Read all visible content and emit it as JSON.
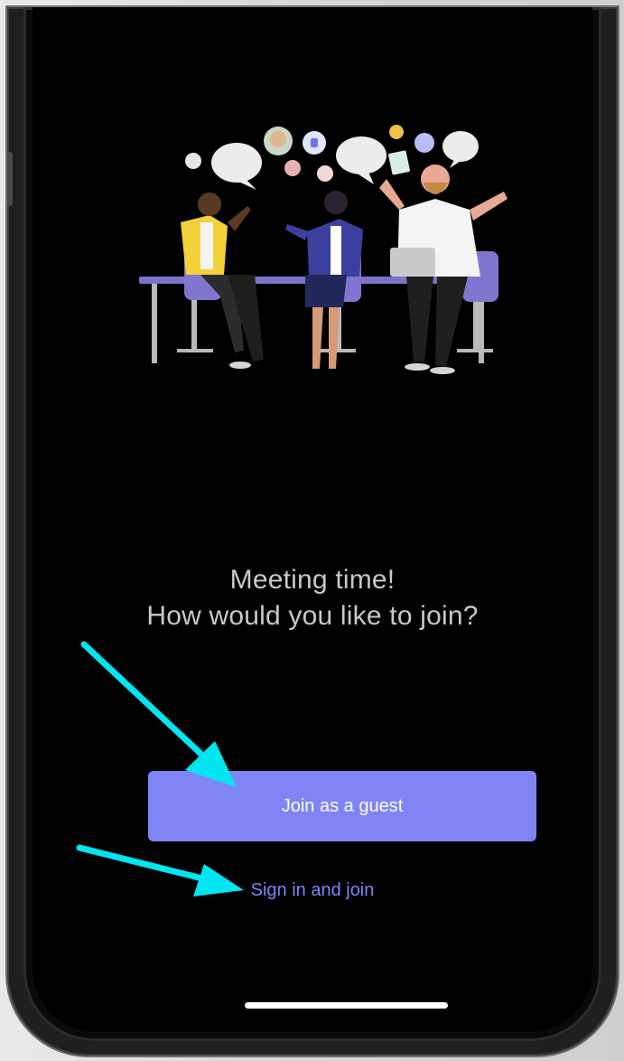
{
  "prompt": {
    "line1": "Meeting time!",
    "line2": "How would you like to join?"
  },
  "actions": {
    "join_guest_label": "Join as a guest",
    "sign_in_label": "Sign in and join"
  },
  "colors": {
    "accent": "#7f85f5",
    "background": "#000000",
    "text": "#c8c8c8",
    "annotation_arrow": "#00e5f0"
  },
  "icons": {
    "illustration": "team-meeting-illustration",
    "annotation_arrows": "cyan-arrow-icon"
  }
}
